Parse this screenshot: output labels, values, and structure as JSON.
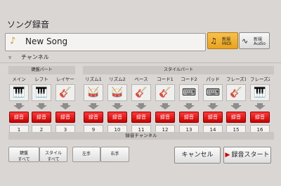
{
  "title": "ソング録音",
  "song": {
    "name": "New Song",
    "icon": "note-sparkle-icon"
  },
  "modes": {
    "midi": {
      "l1": "新規",
      "l2": "MIDI",
      "icon": "music-note-icon"
    },
    "audio": {
      "l1": "新規",
      "l2": "Audio",
      "icon": "waveform-icon"
    }
  },
  "channel_label": "チャンネル",
  "keyboard_part_label": "鍵盤パート",
  "style_part_label": "スタイルパート",
  "tracks": [
    {
      "name": "メイン",
      "icon": "piano-icon",
      "rec": "録音",
      "num": "1"
    },
    {
      "name": "レフト",
      "icon": "piano-icon",
      "rec": "録音",
      "num": "2"
    },
    {
      "name": "レイヤー",
      "icon": "guitar-icon",
      "rec": "録音",
      "num": "3"
    },
    {
      "name": "リズム1",
      "icon": "drums-icon",
      "rec": "録音",
      "num": "9"
    },
    {
      "name": "リズム2",
      "icon": "drums-icon",
      "rec": "録音",
      "num": "10"
    },
    {
      "name": "ベース",
      "icon": "bass-guitar-icon",
      "rec": "録音",
      "num": "11"
    },
    {
      "name": "コード1",
      "icon": "guitar-icon",
      "rec": "録音",
      "num": "12"
    },
    {
      "name": "コード2",
      "icon": "keyboard-icon",
      "rec": "録音",
      "num": "13"
    },
    {
      "name": "パッド",
      "icon": "keyboard-icon",
      "rec": "録音",
      "num": "14"
    },
    {
      "name": "フレーズ1",
      "icon": "guitar-icon",
      "rec": "録音",
      "num": "15"
    },
    {
      "name": "フレーズ2",
      "icon": "piano-icon",
      "rec": "録音",
      "num": "16"
    }
  ],
  "rec_channel_label": "録音チャンネル",
  "bottom": {
    "keyboard_all": {
      "l1": "鍵盤",
      "l2": "すべて"
    },
    "style_all": {
      "l1": "スタイル",
      "l2": "すべて"
    },
    "left_hand": "左手",
    "right_hand": "右手",
    "cancel": "キャンセル",
    "rec_start": "録音スタート"
  },
  "colors": {
    "rec_red": "#e00000",
    "midi_active": "#f0a72a"
  }
}
